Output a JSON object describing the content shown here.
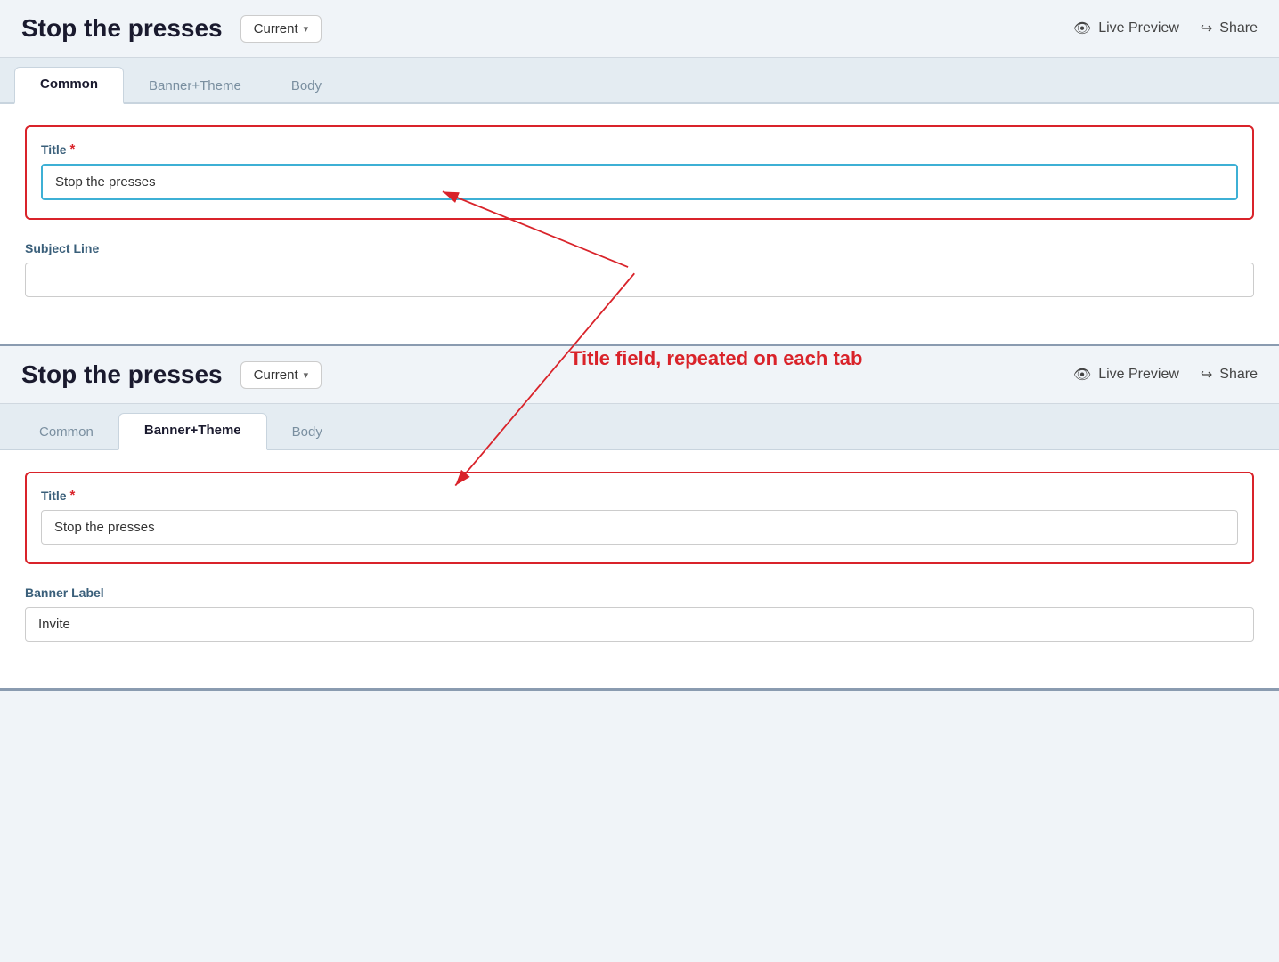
{
  "panel1": {
    "title": "Stop the presses",
    "version_label": "Current",
    "live_preview_label": "Live Preview",
    "share_label": "Share",
    "tabs": [
      {
        "id": "common",
        "label": "Common",
        "active": true
      },
      {
        "id": "banner-theme",
        "label": "Banner+Theme",
        "active": false
      },
      {
        "id": "body",
        "label": "Body",
        "active": false
      }
    ],
    "title_field": {
      "label": "Title",
      "required": true,
      "value": "Stop the presses",
      "placeholder": ""
    },
    "subject_line_field": {
      "label": "Subject Line",
      "value": "",
      "placeholder": ""
    }
  },
  "panel2": {
    "title": "Stop the presses",
    "version_label": "Current",
    "live_preview_label": "Live Preview",
    "share_label": "Share",
    "tabs": [
      {
        "id": "common",
        "label": "Common",
        "active": false
      },
      {
        "id": "banner-theme",
        "label": "Banner+Theme",
        "active": true
      },
      {
        "id": "body",
        "label": "Body",
        "active": false
      }
    ],
    "title_field": {
      "label": "Title",
      "required": true,
      "value": "Stop the presses",
      "placeholder": ""
    },
    "banner_label_field": {
      "label": "Banner Label",
      "value": "Invite",
      "placeholder": ""
    }
  },
  "annotation": {
    "text": "Title field, repeated on each tab"
  }
}
